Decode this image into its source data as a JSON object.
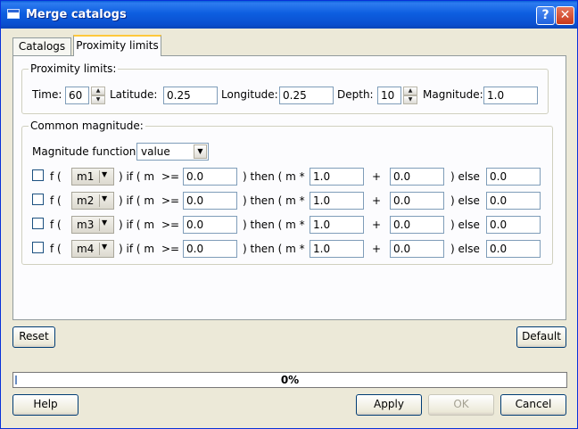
{
  "window": {
    "title": "Merge catalogs",
    "help_glyph": "?",
    "close_glyph": "✕"
  },
  "tabs": [
    "Catalogs",
    "Proximity limits"
  ],
  "proximity": {
    "legend": "Proximity limits:",
    "time_label": "Time:",
    "time_value": "60",
    "latitude_label": "Latitude:",
    "latitude_value": "0.25",
    "longitude_label": "Longitude:",
    "longitude_value": "0.25",
    "depth_label": "Depth:",
    "depth_value": "10",
    "magnitude_label": "Magnitude:",
    "magnitude_value": "1.0"
  },
  "common": {
    "legend": "Common magnitude:",
    "function_label": "Magnitude function:",
    "function_value": "value",
    "rows": [
      {
        "f": "f (",
        "m": "m1",
        "if": ") if ( m",
        "op": ">=",
        "threshold": "0.0",
        "then": ") then ( m *",
        "mult": "1.0",
        "plus": "+",
        "add": "0.0",
        "else": ")  else",
        "else_value": "0.0"
      },
      {
        "f": "f (",
        "m": "m2",
        "if": ") if ( m",
        "op": ">=",
        "threshold": "0.0",
        "then": ") then ( m *",
        "mult": "1.0",
        "plus": "+",
        "add": "0.0",
        "else": ")  else",
        "else_value": "0.0"
      },
      {
        "f": "f (",
        "m": "m3",
        "if": ") if ( m",
        "op": ">=",
        "threshold": "0.0",
        "then": ") then ( m *",
        "mult": "1.0",
        "plus": "+",
        "add": "0.0",
        "else": ")  else",
        "else_value": "0.0"
      },
      {
        "f": "f (",
        "m": "m4",
        "if": ") if ( m",
        "op": ">=",
        "threshold": "0.0",
        "then": ") then ( m *",
        "mult": "1.0",
        "plus": "+",
        "add": "0.0",
        "else": ")  else",
        "else_value": "0.0"
      }
    ]
  },
  "buttons": {
    "reset": "Reset",
    "default": "Default",
    "help": "Help",
    "apply": "Apply",
    "ok": "OK",
    "cancel": "Cancel"
  },
  "progress": {
    "text": "0%",
    "value": 0
  }
}
